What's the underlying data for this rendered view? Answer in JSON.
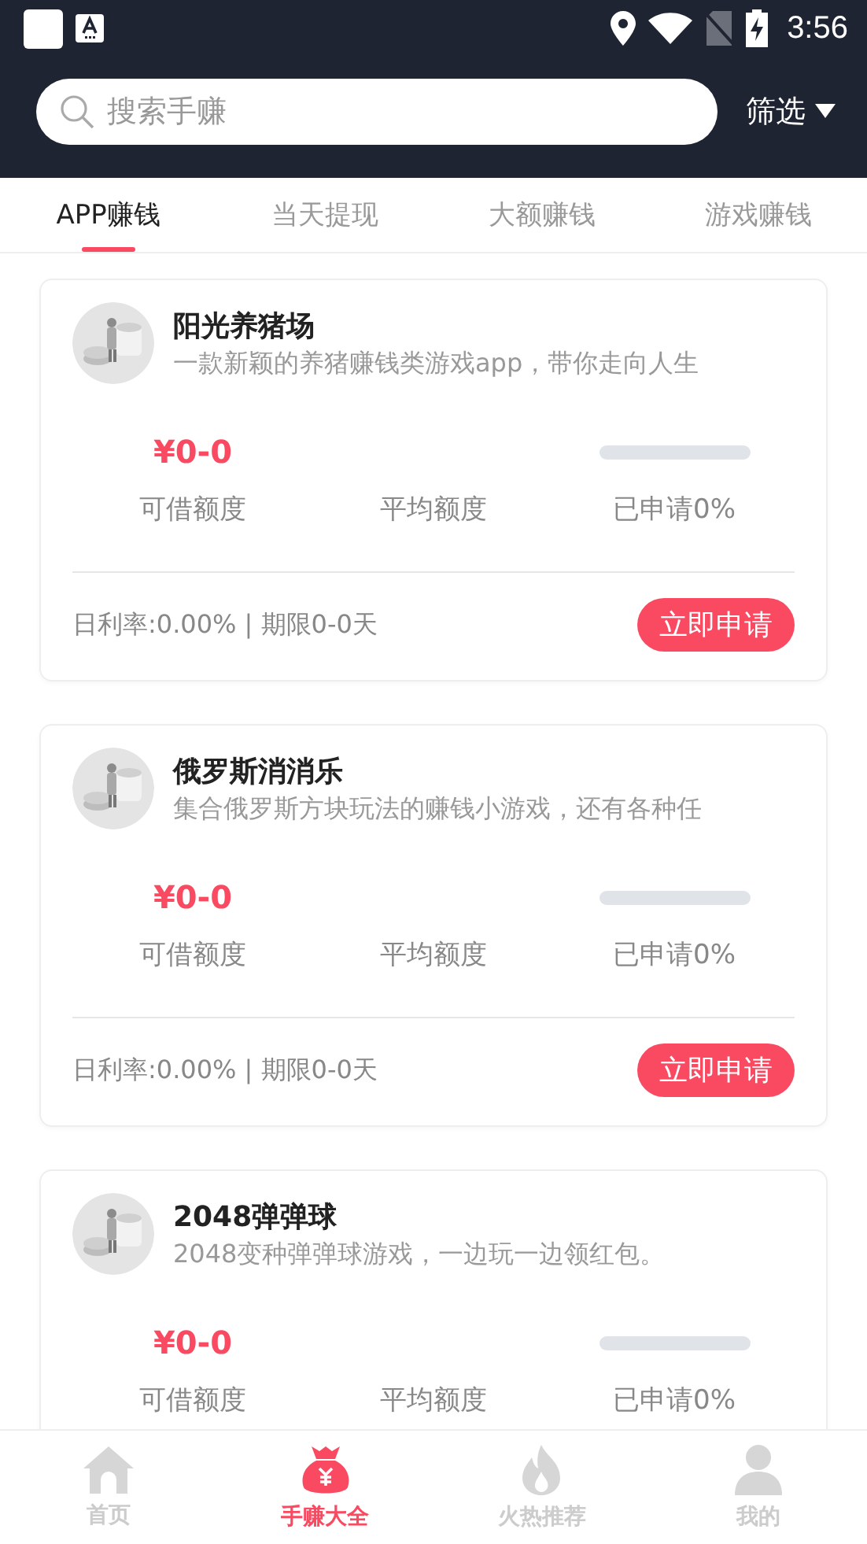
{
  "status_bar": {
    "time": "3:56"
  },
  "search": {
    "placeholder": "搜索手赚"
  },
  "filter": {
    "label": "筛选"
  },
  "tabs": [
    {
      "label": "APP赚钱",
      "selected": true
    },
    {
      "label": "当天提现",
      "selected": false
    },
    {
      "label": "大额赚钱",
      "selected": false
    },
    {
      "label": "游戏赚钱",
      "selected": false
    }
  ],
  "cards": [
    {
      "title": "阳光养猪场",
      "description": "一款新颖的养猪赚钱类游戏app，带你走向人生",
      "amount": "¥0-0",
      "amount_label": "可借额度",
      "average_label": "平均额度",
      "progress": {
        "level": 0,
        "label": "已申请0%"
      },
      "terms": "日利率:0.00% | 期限0-0天",
      "button": "立即申请"
    },
    {
      "title": "俄罗斯消消乐",
      "description": "集合俄罗斯方块玩法的赚钱小游戏，还有各种任",
      "amount": "¥0-0",
      "amount_label": "可借额度",
      "average_label": "平均额度",
      "progress": {
        "level": 0,
        "label": "已申请0%"
      },
      "terms": "日利率:0.00% | 期限0-0天",
      "button": "立即申请"
    },
    {
      "title": "2048弹弹球",
      "description": "2048变种弹弹球游戏，一边玩一边领红包。",
      "amount": "¥0-0",
      "amount_label": "可借额度",
      "average_label": "平均额度",
      "progress": {
        "level": 0,
        "label": "已申请0%"
      }
    }
  ],
  "bottom_nav": [
    {
      "kind": "home",
      "label": "首页",
      "selected": false
    },
    {
      "kind": "moneybag",
      "label": "手赚大全",
      "selected": true
    },
    {
      "kind": "fire",
      "label": "火热推荐",
      "selected": false
    },
    {
      "kind": "person",
      "label": "我的",
      "selected": false
    }
  ]
}
